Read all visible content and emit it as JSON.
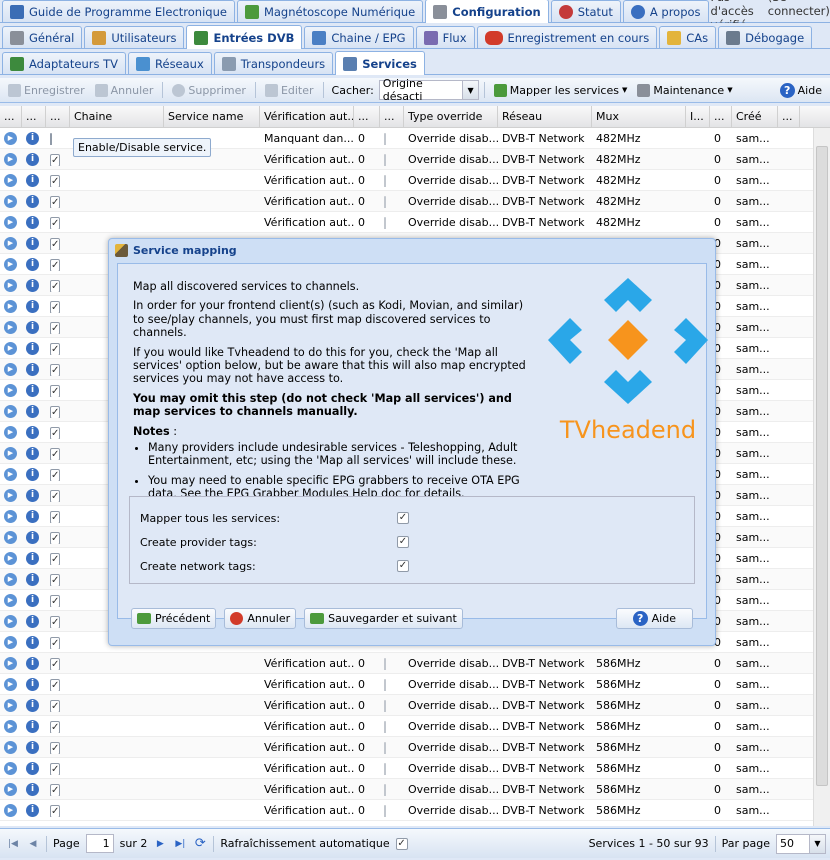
{
  "top_tabs": [
    {
      "label": "Guide de Programme Electronique",
      "icon": "epg-icon",
      "active": false
    },
    {
      "label": "Magnétoscope Numérique",
      "icon": "download-icon",
      "active": false
    },
    {
      "label": "Configuration",
      "icon": "wrench-icon",
      "active": true
    },
    {
      "label": "Statut",
      "icon": "eye-icon",
      "active": false
    },
    {
      "label": "A propos",
      "icon": "info-icon",
      "active": false
    }
  ],
  "status": {
    "access": "Pas d'accès vérifié",
    "login": "(Se connecter)"
  },
  "config_tabs": [
    {
      "label": "Général",
      "icon": "wrench-icon",
      "active": false
    },
    {
      "label": "Utilisateurs",
      "icon": "users-icon",
      "active": false
    },
    {
      "label": "Entrées DVB",
      "icon": "dvb-card-icon",
      "active": true
    },
    {
      "label": "Chaine / EPG",
      "icon": "tv-icon",
      "active": false
    },
    {
      "label": "Flux",
      "icon": "stream-icon",
      "active": false
    },
    {
      "label": "Enregistrement en cours",
      "icon": "rec-icon",
      "active": false
    },
    {
      "label": "CAs",
      "icon": "key-icon",
      "active": false
    },
    {
      "label": "Débogage",
      "icon": "bug-icon",
      "active": false
    }
  ],
  "dvb_tabs": [
    {
      "label": "Adaptateurs TV",
      "icon": "adapter-icon",
      "active": false
    },
    {
      "label": "Réseaux",
      "icon": "network-icon",
      "active": false
    },
    {
      "label": "Transpondeurs",
      "icon": "satellite-icon",
      "active": false
    },
    {
      "label": "Services",
      "icon": "services-icon",
      "active": true
    }
  ],
  "toolbar": {
    "save": "Enregistrer",
    "cancel": "Annuler",
    "delete": "Supprimer",
    "edit": "Editer",
    "hide_label": "Cacher:",
    "hide_value": "Origine désacti",
    "map_services": "Mapper les services",
    "maintenance": "Maintenance",
    "help": "Aide"
  },
  "columns": [
    "...",
    "...",
    "...",
    "Chaine",
    "Service name",
    "Vérification aut...",
    "...",
    "...",
    "Type override",
    "Réseau",
    "Mux",
    "I...",
    "...",
    "Créé",
    "..."
  ],
  "rows_top": [
    {
      "checked": false,
      "verif": "Manquant dan...",
      "n": "0",
      "type": "Override disab...",
      "net": "DVB-T Network",
      "mux": "482MHz",
      "z": "0",
      "created": "sam..."
    },
    {
      "checked": true,
      "verif": "Vérification aut...",
      "n": "0",
      "type": "Override disab...",
      "net": "DVB-T Network",
      "mux": "482MHz",
      "z": "0",
      "created": "sam..."
    },
    {
      "checked": true,
      "verif": "Vérification aut...",
      "n": "0",
      "type": "Override disab...",
      "net": "DVB-T Network",
      "mux": "482MHz",
      "z": "0",
      "created": "sam..."
    },
    {
      "checked": true,
      "verif": "Vérification aut...",
      "n": "0",
      "type": "Override disab...",
      "net": "DVB-T Network",
      "mux": "482MHz",
      "z": "0",
      "created": "sam..."
    },
    {
      "checked": true,
      "verif": "Vérification aut...",
      "n": "0",
      "type": "Override disab...",
      "net": "DVB-T Network",
      "mux": "482MHz",
      "z": "0",
      "created": "sam..."
    },
    {
      "checked": true,
      "verif": "",
      "n": "",
      "type": "",
      "net": "",
      "mux": "",
      "z": "0",
      "created": "sam..."
    },
    {
      "checked": true,
      "verif": "",
      "n": "",
      "type": "",
      "net": "",
      "mux": "",
      "z": "0",
      "created": "sam..."
    },
    {
      "checked": true,
      "verif": "",
      "n": "",
      "type": "",
      "net": "",
      "mux": "",
      "z": "0",
      "created": "sam..."
    },
    {
      "checked": true,
      "verif": "",
      "n": "",
      "type": "",
      "net": "",
      "mux": "",
      "z": "0",
      "created": "sam..."
    },
    {
      "checked": true,
      "verif": "",
      "n": "",
      "type": "",
      "net": "",
      "mux": "",
      "z": "0",
      "created": "sam..."
    },
    {
      "checked": true,
      "verif": "",
      "n": "",
      "type": "",
      "net": "",
      "mux": "",
      "z": "0",
      "created": "sam..."
    },
    {
      "checked": true,
      "verif": "",
      "n": "",
      "type": "",
      "net": "",
      "mux": "",
      "z": "0",
      "created": "sam..."
    },
    {
      "checked": true,
      "verif": "",
      "n": "",
      "type": "",
      "net": "",
      "mux": "",
      "z": "0",
      "created": "sam..."
    },
    {
      "checked": true,
      "verif": "",
      "n": "",
      "type": "",
      "net": "",
      "mux": "",
      "z": "0",
      "created": "sam..."
    },
    {
      "checked": true,
      "verif": "",
      "n": "",
      "type": "",
      "net": "",
      "mux": "",
      "z": "0",
      "created": "sam..."
    },
    {
      "checked": true,
      "verif": "",
      "n": "",
      "type": "",
      "net": "",
      "mux": "",
      "z": "0",
      "created": "sam..."
    },
    {
      "checked": true,
      "verif": "",
      "n": "",
      "type": "",
      "net": "",
      "mux": "",
      "z": "0",
      "created": "sam..."
    },
    {
      "checked": true,
      "verif": "",
      "n": "",
      "type": "",
      "net": "",
      "mux": "",
      "z": "0",
      "created": "sam..."
    },
    {
      "checked": true,
      "verif": "",
      "n": "",
      "type": "",
      "net": "",
      "mux": "",
      "z": "0",
      "created": "sam..."
    },
    {
      "checked": true,
      "verif": "",
      "n": "",
      "type": "",
      "net": "",
      "mux": "",
      "z": "0",
      "created": "sam..."
    },
    {
      "checked": true,
      "verif": "",
      "n": "",
      "type": "",
      "net": "",
      "mux": "",
      "z": "0",
      "created": "sam..."
    },
    {
      "checked": true,
      "verif": "",
      "n": "",
      "type": "",
      "net": "",
      "mux": "",
      "z": "0",
      "created": "sam..."
    },
    {
      "checked": true,
      "verif": "",
      "n": "",
      "type": "",
      "net": "",
      "mux": "",
      "z": "0",
      "created": "sam..."
    },
    {
      "checked": true,
      "verif": "",
      "n": "",
      "type": "",
      "net": "",
      "mux": "",
      "z": "0",
      "created": "sam..."
    },
    {
      "checked": true,
      "verif": "",
      "n": "",
      "type": "",
      "net": "",
      "mux": "",
      "z": "0",
      "created": "sam..."
    },
    {
      "checked": true,
      "verif": "Vérification aut...",
      "n": "0",
      "type": "Override disab...",
      "net": "DVB-T Network",
      "mux": "586MHz",
      "z": "0",
      "created": "sam..."
    },
    {
      "checked": true,
      "verif": "Vérification aut...",
      "n": "0",
      "type": "Override disab...",
      "net": "DVB-T Network",
      "mux": "586MHz",
      "z": "0",
      "created": "sam..."
    },
    {
      "checked": true,
      "verif": "Vérification aut...",
      "n": "0",
      "type": "Override disab...",
      "net": "DVB-T Network",
      "mux": "586MHz",
      "z": "0",
      "created": "sam..."
    },
    {
      "checked": true,
      "verif": "Vérification aut...",
      "n": "0",
      "type": "Override disab...",
      "net": "DVB-T Network",
      "mux": "586MHz",
      "z": "0",
      "created": "sam..."
    },
    {
      "checked": true,
      "verif": "Vérification aut...",
      "n": "0",
      "type": "Override disab...",
      "net": "DVB-T Network",
      "mux": "586MHz",
      "z": "0",
      "created": "sam..."
    },
    {
      "checked": true,
      "verif": "Vérification aut...",
      "n": "0",
      "type": "Override disab...",
      "net": "DVB-T Network",
      "mux": "586MHz",
      "z": "0",
      "created": "sam..."
    },
    {
      "checked": true,
      "verif": "Vérification aut...",
      "n": "0",
      "type": "Override disab...",
      "net": "DVB-T Network",
      "mux": "586MHz",
      "z": "0",
      "created": "sam..."
    },
    {
      "checked": true,
      "verif": "Vérification aut...",
      "n": "0",
      "type": "Override disab...",
      "net": "DVB-T Network",
      "mux": "586MHz",
      "z": "0",
      "created": "sam..."
    }
  ],
  "tooltip": "Enable/Disable service.",
  "dialog": {
    "title": "Service mapping",
    "p1": "Map all discovered services to channels.",
    "p2": "In order for your frontend client(s) (such as Kodi, Movian, and similar) to see/play channels, you must first map discovered services to channels.",
    "p3": "If you would like Tvheadend to do this for you, check the 'Map all services' option below, but be aware that this will also map encrypted services you may not have access to.",
    "p4": "You may omit this step (do not check 'Map all services') and map services to channels manually.",
    "notes_label": "Notes",
    "notes_colon": " :",
    "note1": "Many providers include undesirable services - Teleshopping, Adult Entertainment, etc; using the 'Map all services' will include these.",
    "note2": "You may need to enable specific EPG grabbers to receive OTA EPG data, See the EPG Grabber Modules Help doc for details.",
    "logo_text": "TVheadend",
    "fields": [
      {
        "label": "Mapper tous les services:",
        "checked": true
      },
      {
        "label": "Create provider tags:",
        "checked": true
      },
      {
        "label": "Create network tags:",
        "checked": true
      }
    ],
    "btn_prev": "Précédent",
    "btn_cancel": "Annuler",
    "btn_save_next": "Sauvegarder et suivant",
    "btn_help": "Aide"
  },
  "pager": {
    "page_label": "Page",
    "page_value": "1",
    "of": "sur 2",
    "auto_refresh": "Rafraîchissement automatique",
    "range": "Services 1 - 50 sur 93",
    "per_page_label": "Par page",
    "per_page_value": "50"
  },
  "colors": {
    "accent": "#15428b",
    "logo_blue": "#2aa7e8",
    "logo_orange": "#f7941d"
  }
}
